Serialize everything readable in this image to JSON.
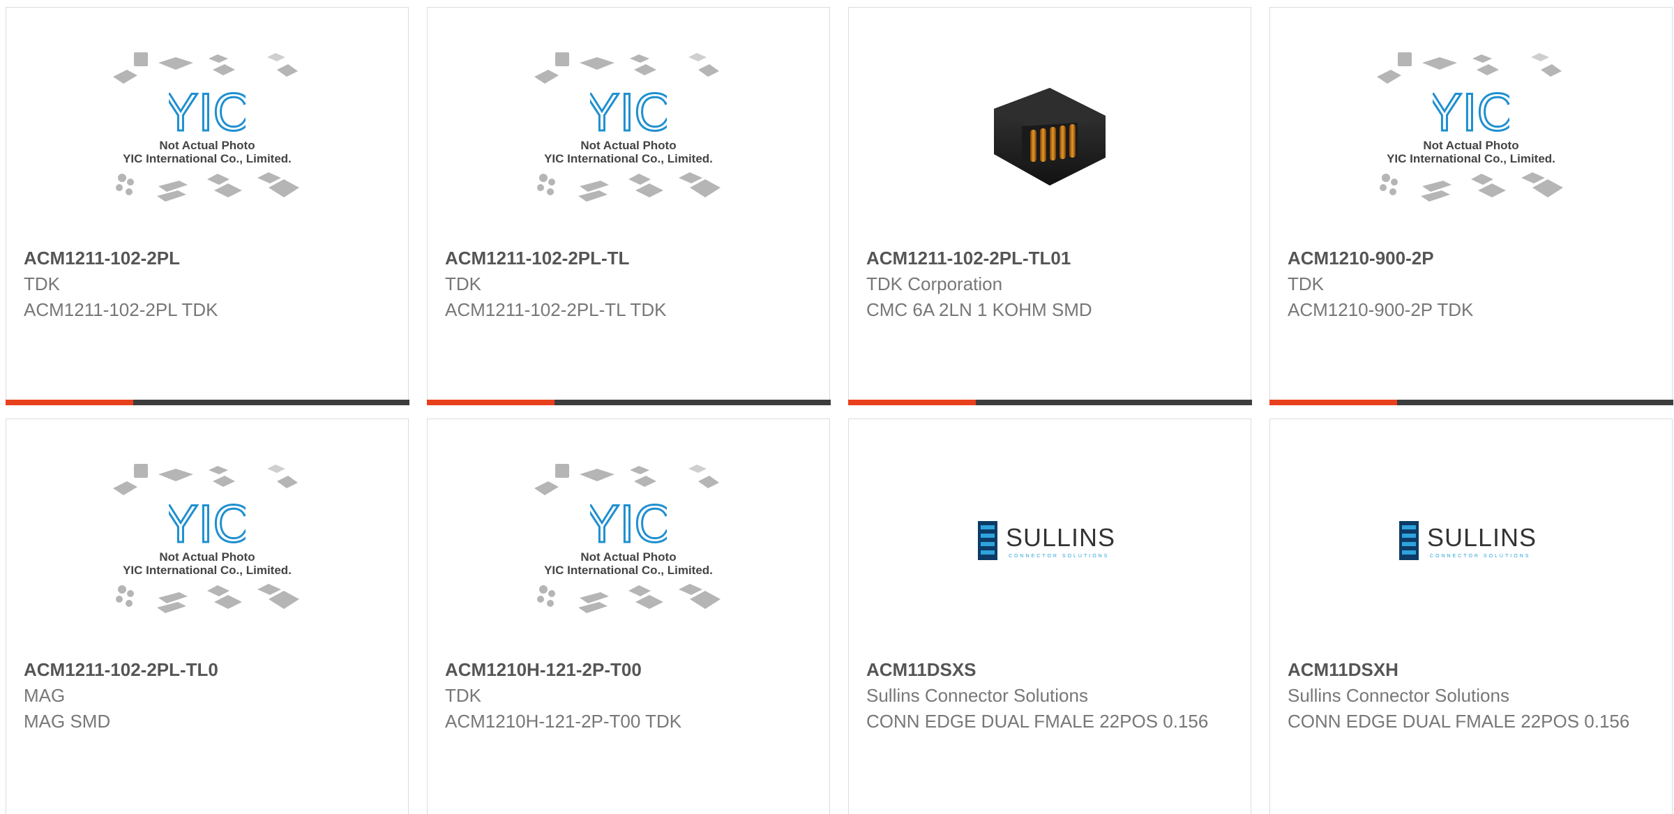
{
  "colors": {
    "accent": "#e8401c",
    "bar": "#3d3d3d",
    "placeholder_logo": "#1e8fd0",
    "sullins_blue": "#1f6fb0"
  },
  "products": [
    {
      "part_number": "ACM1211-102-2PL",
      "manufacturer": "TDK",
      "description": "ACM1211-102-2PL TDK",
      "image": "placeholder",
      "placeholder_text": [
        "Not Actual Photo",
        "YIC International Co., Limited."
      ],
      "logo": "YIC"
    },
    {
      "part_number": "ACM1211-102-2PL-TL",
      "manufacturer": "TDK",
      "description": "ACM1211-102-2PL-TL TDK",
      "image": "placeholder",
      "placeholder_text": [
        "Not Actual Photo",
        "YIC International Co., Limited."
      ],
      "logo": "YIC"
    },
    {
      "part_number": "ACM1211-102-2PL-TL01",
      "manufacturer": "TDK Corporation",
      "description": "CMC 6A 2LN 1 KOHM SMD",
      "image": "inductor-photo"
    },
    {
      "part_number": "ACM1210-900-2P",
      "manufacturer": "TDK",
      "description": "ACM1210-900-2P TDK",
      "image": "placeholder",
      "placeholder_text": [
        "Not Actual Photo",
        "YIC International Co., Limited."
      ],
      "logo": "YIC"
    },
    {
      "part_number": "ACM1211-102-2PL-TL0",
      "manufacturer": "MAG",
      "description": "MAG SMD",
      "image": "placeholder",
      "placeholder_text": [
        "Not Actual Photo",
        "YIC International Co., Limited."
      ],
      "logo": "YIC"
    },
    {
      "part_number": "ACM1210H-121-2P-T00",
      "manufacturer": "TDK",
      "description": "ACM1210H-121-2P-T00 TDK",
      "image": "placeholder",
      "placeholder_text": [
        "Not Actual Photo",
        "YIC International Co., Limited."
      ],
      "logo": "YIC"
    },
    {
      "part_number": "ACM11DSXS",
      "manufacturer": "Sullins Connector Solutions",
      "description": "CONN EDGE DUAL FMALE 22POS 0.156",
      "image": "sullins-logo",
      "logo": "SULLINS",
      "logo_tagline": "CONNECTOR SOLUTIONS"
    },
    {
      "part_number": "ACM11DSXH",
      "manufacturer": "Sullins Connector Solutions",
      "description": "CONN EDGE DUAL FMALE 22POS 0.156",
      "image": "sullins-logo",
      "logo": "SULLINS",
      "logo_tagline": "CONNECTOR SOLUTIONS"
    }
  ]
}
